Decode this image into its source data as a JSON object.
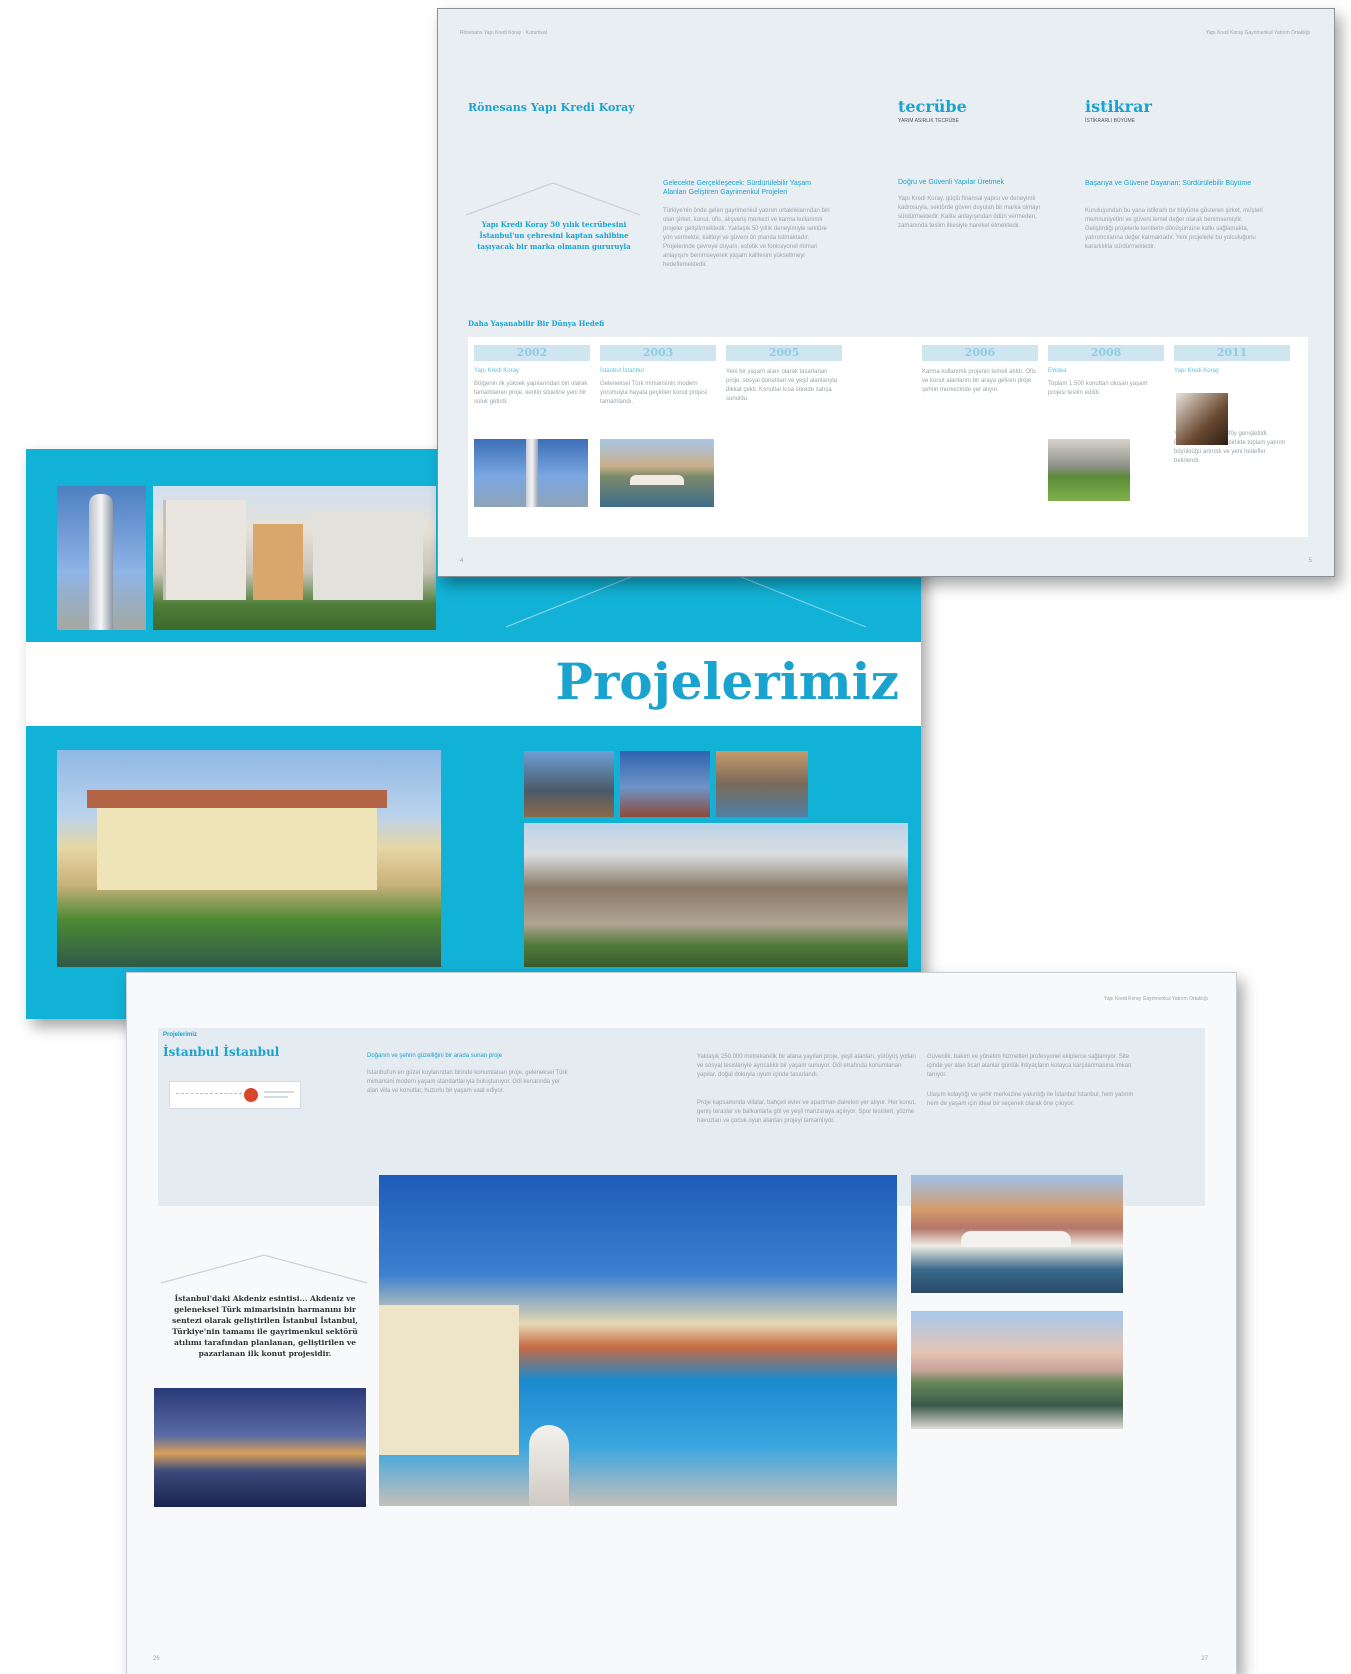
{
  "spread_a": {
    "header_left": "Rönesans Yapı Kredi Koray · Kurumsal",
    "header_right": "Yapı Kredi Koray Gayrimenkul Yatırım Ortaklığı",
    "title": "Rönesans Yapı Kredi Koray",
    "arch_text": "Yapı Kredi Koray 50 yılık tecrübesini İstanbul'un çehresini kaptan sahibine taşıyacak bir marka olmanın gururuyla yaşıyor.",
    "col1_heading": "Gelecekte Gerçekleşecek: Sürdürülebilir Yaşam Alanları Geliştiren Gayrimenkul Projeleri",
    "col1_text": "Türkiye'nin önde gelen gayrimenkul yatırım ortaklıklarından biri olan şirket, konut, ofis, alışveriş merkezi ve karma kullanımlı projeler geliştirmektedir. Yaklaşık 50 yıllık deneyimiyle sektöre yön vermekte, kaliteyi ve güveni ön planda tutmaktadır. Projelerinde çevreye duyarlı, estetik ve fonksiyonel mimari anlayışını benimseyerek yaşam kalitesini yükseltmeyi hedeflemektedir.",
    "col2_title": "tecrübe",
    "col2_sub": "YARIM ASIRLIK TECRÜBE",
    "col2_heading": "Doğru ve Güvenli Yapılar Üretmek",
    "col2_text": "Yapı Kredi Koray, güçlü finansal yapısı ve deneyimli kadrosuyla, sektörde güven duyulan bir marka olmayı sürdürmektedir. Kalite anlayışından ödün vermeden, zamanında teslim ilkesiyle hareket etmektedir.",
    "col3_title": "istikrar",
    "col3_sub": "İSTİKRARLI BÜYÜME",
    "col3_heading": "Başarıya ve Güvene Dayanan: Sürdürülebilir Büyüme",
    "col3_text": "Kuruluşundan bu yana istikrarlı bir büyüme gösteren şirket, müşteri memnuniyetini ve güveni temel değer olarak benimsemiştir. Geliştirdiği projelerle kentlerin dönüşümüne katkı sağlamakta, yatırımcılarına değer katmaktadır. Yeni projelerle bu yolculuğunu kararlılıkla sürdürmektedir.",
    "timeline_heading": "Daha Yaşanabilir Bir Dünya Hedefi",
    "timeline": [
      {
        "year": "2002",
        "name": "Yapı Kredi Koray",
        "text": "Bölgenin ilk yüksek yapılarından biri olarak tamamlanan proje, kentin siluetine yeni bir soluk getirdi."
      },
      {
        "year": "2003",
        "name": "İstanbul İstanbul",
        "text": "Geleneksel Türk mimarisinin modern yorumuyla hayata geçirilen konut projesi tamamlandı."
      },
      {
        "year": "2005",
        "name": "",
        "text": "Yeni bir yaşam alanı olarak tasarlanan proje, sosyal donatıları ve yeşil alanlarıyla dikkat çekti. Konutlar kısa sürede satışa sunuldu."
      },
      {
        "year": "2006",
        "name": "",
        "text": "Karma kullanımlı projenin temeli atıldı. Ofis ve konut alanlarını bir araya getiren proje şehrin merkezinde yer alıyor."
      },
      {
        "year": "2008",
        "name": "Evidea",
        "text": "Toplam 1.500 konuttan oluşan yaşam projesi teslim edildi."
      },
      {
        "year": "2011",
        "name": "Yapı Kredi Koray",
        "text": "Yeni yatırımlarla portföy genişletildi. Bölgedeki projelerle birlikte toplam yatırım büyüklüğü artırıldı ve yeni hedefler belirlendi."
      }
    ],
    "page_left": "4",
    "page_right": "5"
  },
  "spread_b": {
    "title": "Projelerimiz"
  },
  "spread_c": {
    "header_right": "Yapı Kredi Koray Gayrimenkul Yatırım Ortaklığı",
    "section": "Projelerimiz",
    "project_title": "İstanbul İstanbul",
    "intro_heading": "Doğanın ve şehrin güzelliğini bir arada sunan proje",
    "intro_text": "İstanbul'un en güzel koylarından birinde konumlanan proje, geleneksel Türk mimarisini modern yaşam standartlarıyla buluşturuyor. Göl kenarında yer alan villa ve konutlar, huzurlu bir yaşam vaat ediyor.",
    "col2_text_a": "Yaklaşık 250.000 metrekarelik bir alana yayılan proje, yeşil alanları, yürüyüş yolları ve sosyal tesisleriyle ayrıcalıklı bir yaşam sunuyor. Göl etrafında konumlanan yapılar, doğal dokuyla uyum içinde tasarlandı.",
    "col2_text_b": "Proje kapsamında villalar, bahçeli evler ve apartman daireleri yer alıyor. Her konut, geniş teraslar ve balkonlarla göl ve yeşil manzaraya açılıyor. Spor tesisleri, yüzme havuzları ve çocuk oyun alanları projeyi tamamlıyor.",
    "col3_text_a": "Güvenlik, bakım ve yönetim hizmetleri profesyonel ekiplerce sağlanıyor. Site içinde yer alan ticari alanlar günlük ihtiyaçların kolayca karşılanmasına imkan tanıyor.",
    "col3_text_b": "Ulaşım kolaylığı ve şehir merkezine yakınlığı ile İstanbul İstanbul, hem yatırım hem de yaşam için ideal bir seçenek olarak öne çıkıyor.",
    "quote": "İstanbul'daki Akdeniz esintisi... Akdeniz ve geleneksel Türk mimarisinin harmanını bir sentezi olarak geliştirilen İstanbul İstanbul, Türkiye'nin tamamı ile gayrimenkul sektörü atılımı tarafından planlanan, geliştirilen ve pazarlanan ilk konut projesidir.",
    "page_left": "26",
    "page_right": "27"
  },
  "colors": {
    "accent": "#12b2d6",
    "title_blue": "#1aa3cf",
    "panel": "#e4ebf1"
  }
}
